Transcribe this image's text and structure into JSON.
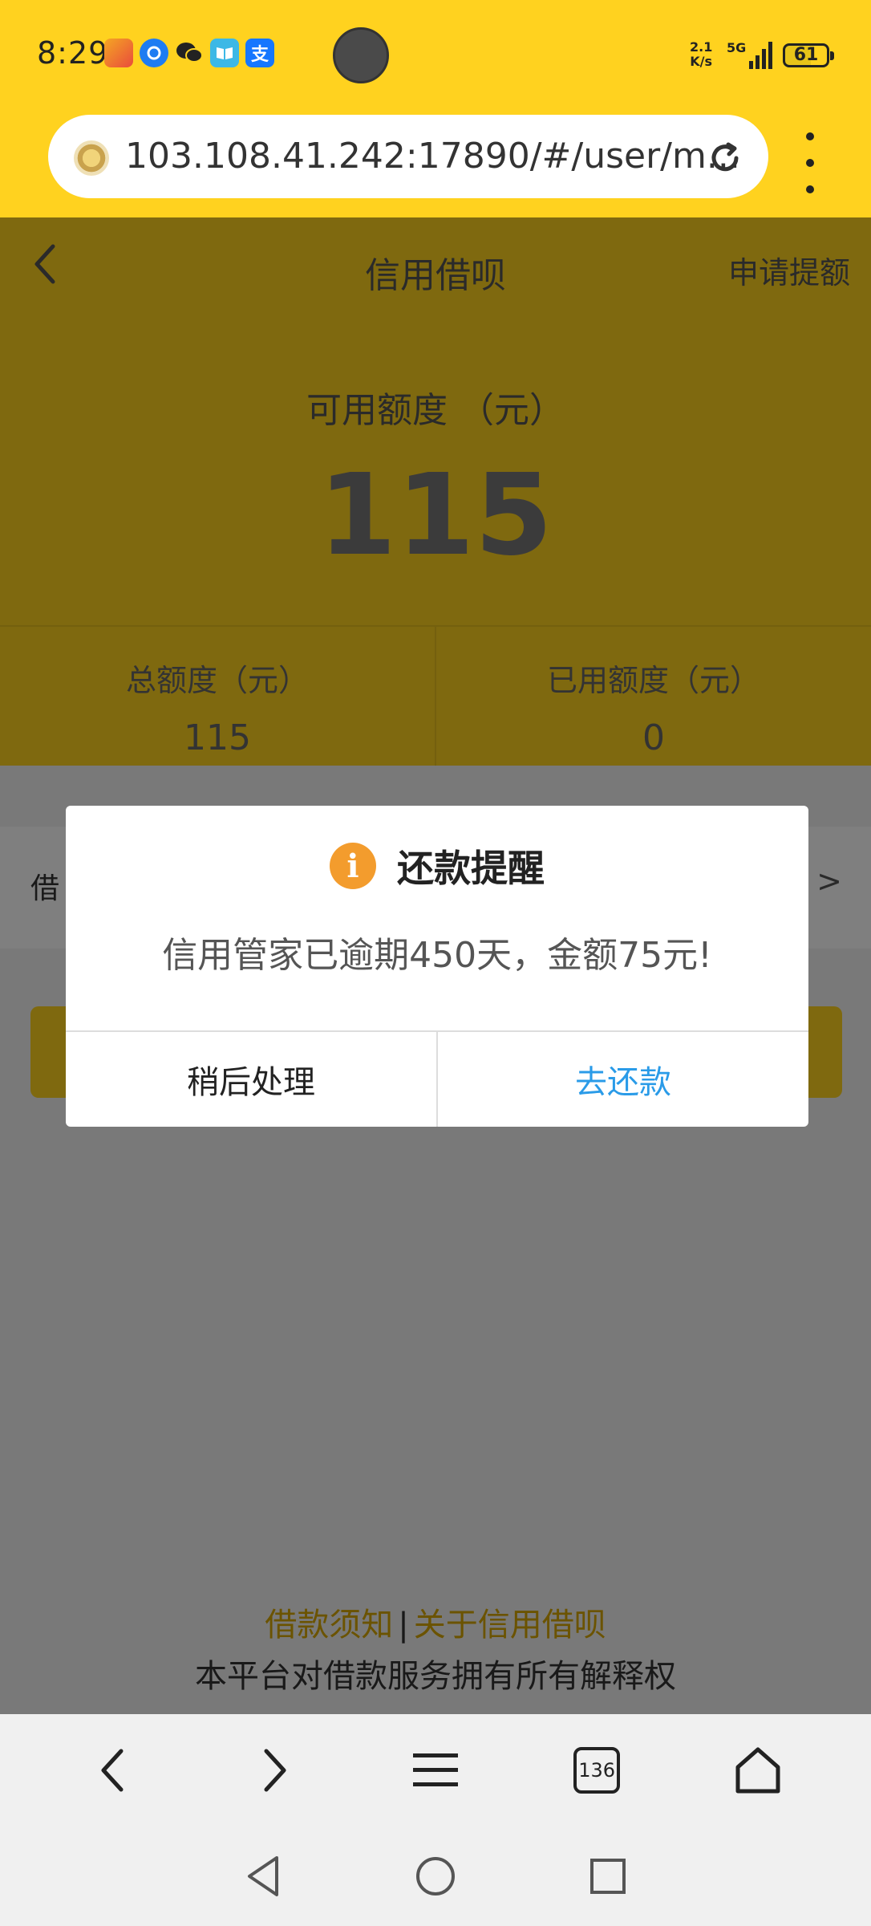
{
  "status_bar": {
    "time": "8:29",
    "net_speed_value": "2.1",
    "net_speed_unit": "K/s",
    "network": "5G",
    "battery": "61",
    "app_icons": [
      "kuaishou-icon",
      "qq-browser-icon",
      "wechat-icon",
      "reader-icon",
      "alipay-icon"
    ],
    "alipay_char": "支"
  },
  "browser": {
    "url": "103.108.41.242:17890/#/user/m...",
    "tab_count": "136"
  },
  "header": {
    "title": "信用借呗",
    "apply_link": "申请提额",
    "available_label": "可用额度 （元）",
    "available_value": "115",
    "total_label": "总额度（元）",
    "total_value": "115",
    "used_label": "已用额度（元）",
    "used_value": "0"
  },
  "content": {
    "borrow_label": "借",
    "borrow_arrow": ">"
  },
  "footer": {
    "link_notice": "借款须知",
    "separator": "|",
    "link_about": "关于信用借呗",
    "note": "本平台对借款服务拥有所有解释权"
  },
  "dialog": {
    "icon_glyph": "i",
    "title": "还款提醒",
    "message": "信用管家已逾期450天，金额75元!",
    "later_button": "稍后处理",
    "repay_button": "去还款"
  },
  "colors": {
    "brand_yellow": "#ffd21f",
    "link_blue": "#2a9be8",
    "warning_orange": "#f39c2d"
  }
}
